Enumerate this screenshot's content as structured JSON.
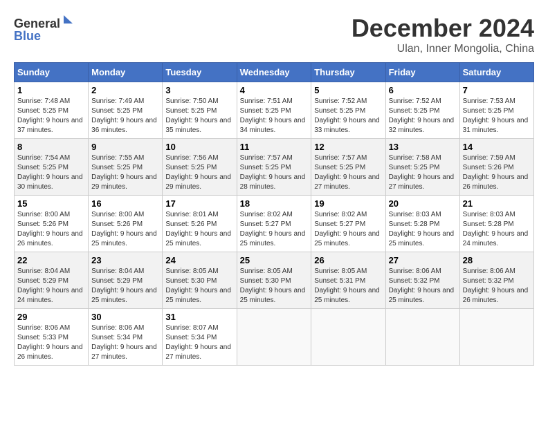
{
  "logo": {
    "line1": "General",
    "line2": "Blue"
  },
  "title": "December 2024",
  "location": "Ulan, Inner Mongolia, China",
  "days_of_week": [
    "Sunday",
    "Monday",
    "Tuesday",
    "Wednesday",
    "Thursday",
    "Friday",
    "Saturday"
  ],
  "weeks": [
    [
      {
        "day": "1",
        "sunrise": "7:48 AM",
        "sunset": "5:25 PM",
        "daylight": "9 hours and 37 minutes."
      },
      {
        "day": "2",
        "sunrise": "7:49 AM",
        "sunset": "5:25 PM",
        "daylight": "9 hours and 36 minutes."
      },
      {
        "day": "3",
        "sunrise": "7:50 AM",
        "sunset": "5:25 PM",
        "daylight": "9 hours and 35 minutes."
      },
      {
        "day": "4",
        "sunrise": "7:51 AM",
        "sunset": "5:25 PM",
        "daylight": "9 hours and 34 minutes."
      },
      {
        "day": "5",
        "sunrise": "7:52 AM",
        "sunset": "5:25 PM",
        "daylight": "9 hours and 33 minutes."
      },
      {
        "day": "6",
        "sunrise": "7:52 AM",
        "sunset": "5:25 PM",
        "daylight": "9 hours and 32 minutes."
      },
      {
        "day": "7",
        "sunrise": "7:53 AM",
        "sunset": "5:25 PM",
        "daylight": "9 hours and 31 minutes."
      }
    ],
    [
      {
        "day": "8",
        "sunrise": "7:54 AM",
        "sunset": "5:25 PM",
        "daylight": "9 hours and 30 minutes."
      },
      {
        "day": "9",
        "sunrise": "7:55 AM",
        "sunset": "5:25 PM",
        "daylight": "9 hours and 29 minutes."
      },
      {
        "day": "10",
        "sunrise": "7:56 AM",
        "sunset": "5:25 PM",
        "daylight": "9 hours and 29 minutes."
      },
      {
        "day": "11",
        "sunrise": "7:57 AM",
        "sunset": "5:25 PM",
        "daylight": "9 hours and 28 minutes."
      },
      {
        "day": "12",
        "sunrise": "7:57 AM",
        "sunset": "5:25 PM",
        "daylight": "9 hours and 27 minutes."
      },
      {
        "day": "13",
        "sunrise": "7:58 AM",
        "sunset": "5:25 PM",
        "daylight": "9 hours and 27 minutes."
      },
      {
        "day": "14",
        "sunrise": "7:59 AM",
        "sunset": "5:26 PM",
        "daylight": "9 hours and 26 minutes."
      }
    ],
    [
      {
        "day": "15",
        "sunrise": "8:00 AM",
        "sunset": "5:26 PM",
        "daylight": "9 hours and 26 minutes."
      },
      {
        "day": "16",
        "sunrise": "8:00 AM",
        "sunset": "5:26 PM",
        "daylight": "9 hours and 25 minutes."
      },
      {
        "day": "17",
        "sunrise": "8:01 AM",
        "sunset": "5:26 PM",
        "daylight": "9 hours and 25 minutes."
      },
      {
        "day": "18",
        "sunrise": "8:02 AM",
        "sunset": "5:27 PM",
        "daylight": "9 hours and 25 minutes."
      },
      {
        "day": "19",
        "sunrise": "8:02 AM",
        "sunset": "5:27 PM",
        "daylight": "9 hours and 25 minutes."
      },
      {
        "day": "20",
        "sunrise": "8:03 AM",
        "sunset": "5:28 PM",
        "daylight": "9 hours and 25 minutes."
      },
      {
        "day": "21",
        "sunrise": "8:03 AM",
        "sunset": "5:28 PM",
        "daylight": "9 hours and 24 minutes."
      }
    ],
    [
      {
        "day": "22",
        "sunrise": "8:04 AM",
        "sunset": "5:29 PM",
        "daylight": "9 hours and 24 minutes."
      },
      {
        "day": "23",
        "sunrise": "8:04 AM",
        "sunset": "5:29 PM",
        "daylight": "9 hours and 25 minutes."
      },
      {
        "day": "24",
        "sunrise": "8:05 AM",
        "sunset": "5:30 PM",
        "daylight": "9 hours and 25 minutes."
      },
      {
        "day": "25",
        "sunrise": "8:05 AM",
        "sunset": "5:30 PM",
        "daylight": "9 hours and 25 minutes."
      },
      {
        "day": "26",
        "sunrise": "8:05 AM",
        "sunset": "5:31 PM",
        "daylight": "9 hours and 25 minutes."
      },
      {
        "day": "27",
        "sunrise": "8:06 AM",
        "sunset": "5:32 PM",
        "daylight": "9 hours and 25 minutes."
      },
      {
        "day": "28",
        "sunrise": "8:06 AM",
        "sunset": "5:32 PM",
        "daylight": "9 hours and 26 minutes."
      }
    ],
    [
      {
        "day": "29",
        "sunrise": "8:06 AM",
        "sunset": "5:33 PM",
        "daylight": "9 hours and 26 minutes."
      },
      {
        "day": "30",
        "sunrise": "8:06 AM",
        "sunset": "5:34 PM",
        "daylight": "9 hours and 27 minutes."
      },
      {
        "day": "31",
        "sunrise": "8:07 AM",
        "sunset": "5:34 PM",
        "daylight": "9 hours and 27 minutes."
      },
      null,
      null,
      null,
      null
    ]
  ],
  "labels": {
    "sunrise": "Sunrise:",
    "sunset": "Sunset:",
    "daylight": "Daylight:"
  }
}
